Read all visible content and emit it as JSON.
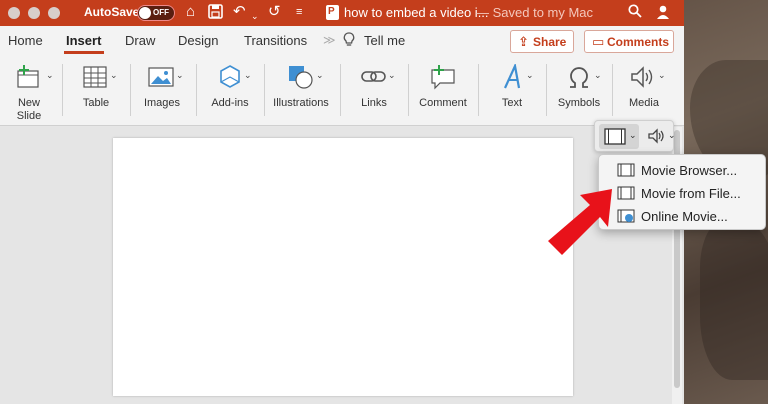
{
  "titlebar": {
    "autosave_label": "AutoSave",
    "autosave_state": "OFF",
    "document_title": "how to embed a video i...",
    "save_status": "— Saved to my Mac",
    "accent_color": "#c43e1c",
    "icons": [
      "home-icon",
      "save-icon",
      "undo-icon",
      "redo-icon",
      "customize-icon",
      "search-icon",
      "account-icon"
    ]
  },
  "tabs": {
    "items": [
      "Home",
      "Insert",
      "Draw",
      "Design",
      "Transitions"
    ],
    "active": "Insert",
    "tell_me": "Tell me",
    "share": "Share",
    "comments": "Comments"
  },
  "ribbon": {
    "new_slide": "New Slide",
    "table": "Table",
    "images": "Images",
    "addins": "Add-ins",
    "illustrations": "Illustrations",
    "links": "Links",
    "comment": "Comment",
    "text": "Text",
    "symbols": "Symbols",
    "media": "Media"
  },
  "media_menu": {
    "items": [
      "Movie Browser...",
      "Movie from File...",
      "Online Movie..."
    ]
  }
}
